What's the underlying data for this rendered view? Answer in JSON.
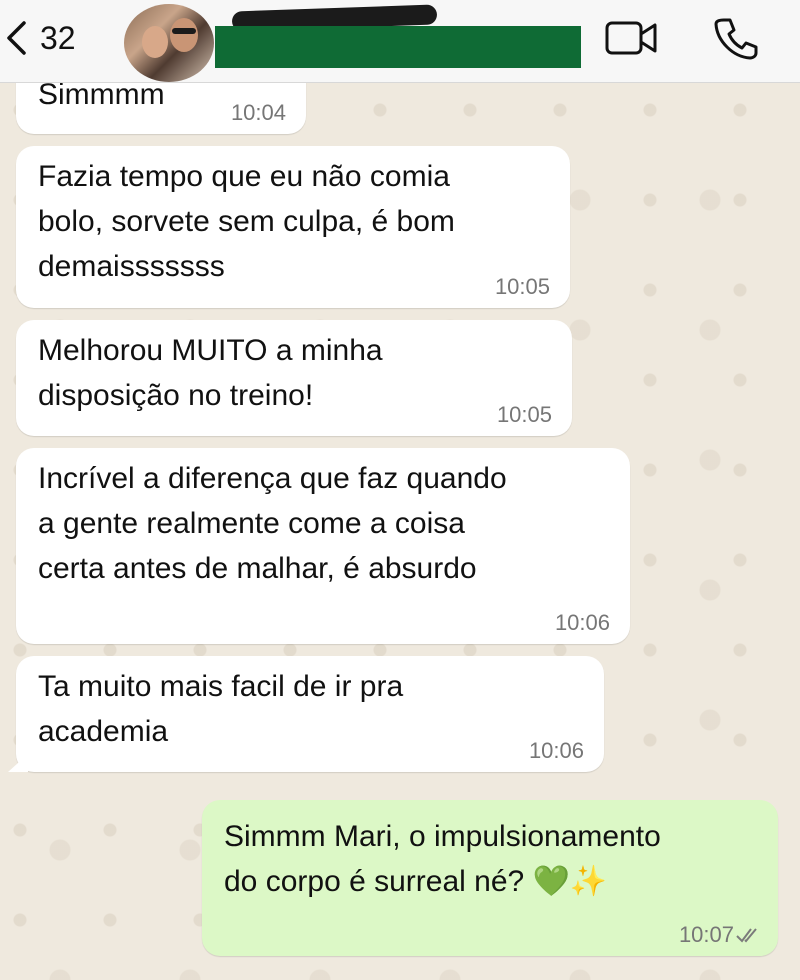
{
  "header": {
    "unread_count": "32"
  },
  "icons": {
    "back": "chevron-left-icon",
    "video": "video-camera-icon",
    "call": "phone-icon",
    "read": "double-check-icon"
  },
  "colors": {
    "incoming_bubble": "#ffffff",
    "outgoing_bubble": "#dcf8c6",
    "redaction": "#0f6b35"
  },
  "messages": [
    {
      "direction": "in",
      "lines": [
        "Simmmm"
      ],
      "time": "10:04"
    },
    {
      "direction": "in",
      "lines": [
        "Fazia tempo que eu não comia",
        "bolo, sorvete sem culpa, é bom",
        "demaisssssss"
      ],
      "time": "10:05"
    },
    {
      "direction": "in",
      "lines": [
        "Melhorou MUITO a minha",
        "disposição no treino!"
      ],
      "time": "10:05"
    },
    {
      "direction": "in",
      "lines": [
        "Incrível a diferença que faz quando",
        "a gente realmente come a coisa",
        "certa antes de malhar, é absurdo"
      ],
      "time": "10:06"
    },
    {
      "direction": "in",
      "lines": [
        "Ta muito mais facil de ir pra",
        "academia"
      ],
      "time": "10:06"
    },
    {
      "direction": "out",
      "lines": [
        "Simmm Mari, o impulsionamento",
        "do corpo é surreal né? 💚✨"
      ],
      "time": "10:07"
    }
  ]
}
